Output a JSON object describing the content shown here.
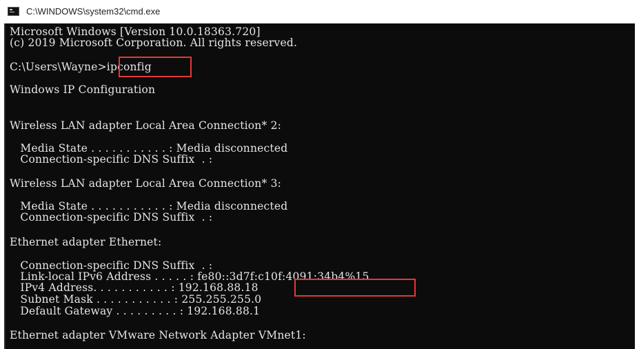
{
  "window": {
    "title": "C:\\WINDOWS\\system32\\cmd.exe"
  },
  "console": {
    "lines": [
      "Microsoft Windows [Version 10.0.18363.720]",
      "(c) 2019 Microsoft Corporation. All rights reserved.",
      "C:\\Users\\Wayne>ipconfig",
      "Windows IP Configuration",
      "Wireless LAN adapter Local Area Connection* 2:",
      "   Media State . . . . . . . . . . . : Media disconnected",
      "   Connection-specific DNS Suffix  . :",
      "Wireless LAN adapter Local Area Connection* 3:",
      "   Media State . . . . . . . . . . . : Media disconnected",
      "   Connection-specific DNS Suffix  . :",
      "Ethernet adapter Ethernet:",
      "   Connection-specific DNS Suffix  . :",
      "   Link-local IPv6 Address . . . . . : fe80::3d7f:c10f:4091:34b4%15",
      "   IPv4 Address. . . . . . . . . . . : 192.168.88.18",
      "   Subnet Mask . . . . . . . . . . . : 255.255.255.0",
      "   Default Gateway . . . . . . . . . : 192.168.88.1",
      "Ethernet adapter VMware Network Adapter VMnet1:"
    ]
  },
  "highlights": {
    "command": "ipconfig",
    "ipv4": "192.168.88.18"
  },
  "colors": {
    "console_bg": "#0c0c0c",
    "console_text": "#e6e6e6",
    "highlight_border": "#e53935"
  }
}
